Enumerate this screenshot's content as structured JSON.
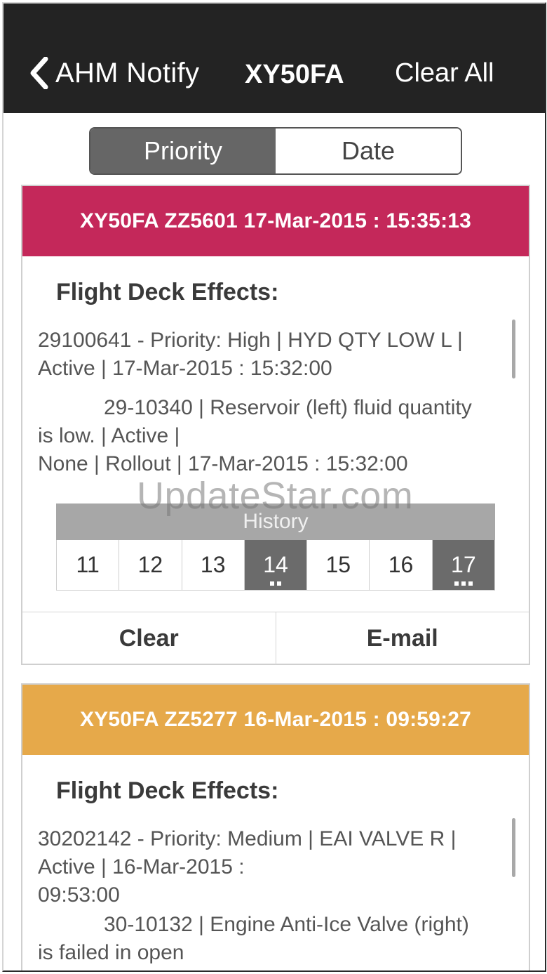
{
  "navbar": {
    "back_label": "AHM Notify",
    "title": "XY50FA",
    "clear_all_label": "Clear All"
  },
  "segment": {
    "priority_label": "Priority",
    "date_label": "Date",
    "selected": "Priority"
  },
  "notifications": [
    {
      "header": "XY50FA ZZ5601 17-Mar-2015 : 15:35:13",
      "color": "#c4285a",
      "fde_title": "Flight Deck Effects:",
      "line1": "29100641 - Priority: High | HYD QTY LOW L |",
      "line2": "Active | 17-Mar-2015 :  15:32:00",
      "detail1": "29-10340 | Reservoir (left) fluid quantity",
      "detail2": "is low. | Active |",
      "detail3": "None | Rollout |   17-Mar-2015 : 15:32:00",
      "history": {
        "label": "History",
        "days": [
          "11",
          "12",
          "13",
          "14",
          "15",
          "16",
          "17"
        ],
        "selected_days": [
          "14",
          "17"
        ]
      },
      "clear_label": "Clear",
      "email_label": "E-mail"
    },
    {
      "header": "XY50FA ZZ5277 16-Mar-2015 : 09:59:27",
      "color": "#e6a94a",
      "fde_title": "Flight Deck Effects:",
      "line1": "30202142 - Priority: Medium | EAI VALVE R |",
      "line2": "Active | 16-Mar-2015 :",
      "line3": "09:53:00",
      "detail1": "30-10132 | Engine Anti-Ice Valve (right)",
      "detail2": "is failed in open"
    }
  ],
  "watermark": "UpdateStar.com",
  "icons": {
    "back": "chevron-left-icon"
  }
}
